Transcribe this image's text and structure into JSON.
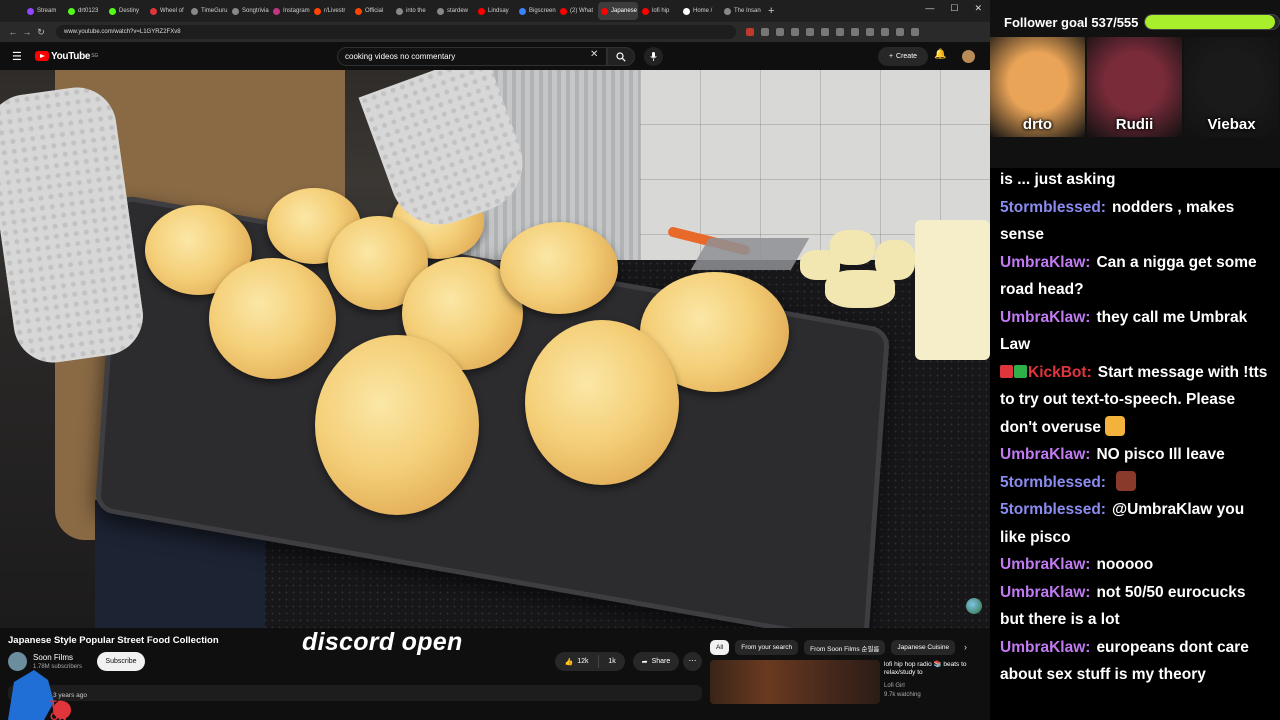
{
  "browser": {
    "tabs": [
      {
        "label": "Stream",
        "color": "#9146ff"
      },
      {
        "label": "drt0123",
        "color": "#53fc18"
      },
      {
        "label": "Destiny",
        "color": "#53fc18"
      },
      {
        "label": "Wheel of",
        "color": "#e0353b"
      },
      {
        "label": "TimeGuru",
        "color": "#888888"
      },
      {
        "label": "Songtrivia",
        "color": "#888888"
      },
      {
        "label": "Instagram",
        "color": "#c13584"
      },
      {
        "label": "r/Livestr",
        "color": "#ff4500"
      },
      {
        "label": "Official",
        "color": "#ff4500"
      },
      {
        "label": "into the",
        "color": "#888888"
      },
      {
        "label": "stardew",
        "color": "#888888"
      },
      {
        "label": "Lindsay",
        "color": "#ff0000"
      },
      {
        "label": "Bigscreen",
        "color": "#3b82f6"
      },
      {
        "label": "(2) What",
        "color": "#ff0000"
      },
      {
        "label": "Japanese",
        "color": "#ff0000",
        "active": true
      },
      {
        "label": "lofi hip",
        "color": "#ff0000"
      },
      {
        "label": "Home /",
        "color": "#ffffff"
      },
      {
        "label": "The Insane",
        "color": "#888888"
      }
    ],
    "new_tab": "+",
    "url": "www.youtube.com/watch?v=L1GYRZ2FXv8"
  },
  "youtube": {
    "logo_text": "YouTube",
    "logo_country": "SG",
    "search_value": "cooking videos no commentary",
    "create_label": "Create",
    "video_title": "Japanese Style Popular Street Food Collection",
    "overlay_caption": "discord open",
    "channel_name": "Soon Films",
    "subscribers": "1.78M subscribers",
    "subscribe_label": "Subscribe",
    "upload_age": "3 years ago",
    "like_count": "12k",
    "dislike_count": "1k",
    "share_label": "Share",
    "chips": [
      "All",
      "From your search",
      "From Soon Films 순필름",
      "Japanese Cuisine"
    ],
    "recommendation": {
      "title": "lofi hip hop radio 📚 beats to relax/study to",
      "channel": "Lofi Girl",
      "watching": "9.7k watching"
    }
  },
  "stream": {
    "follower_goal_label": "Follower goal 537/555",
    "follower_progress": 0.967,
    "members": [
      {
        "name": "drto",
        "bg": "#e9a457"
      },
      {
        "name": "Rudii",
        "bg": "#7a2b3a"
      },
      {
        "name": "Viebax",
        "bg": "#1a1a1a"
      }
    ],
    "chat": [
      {
        "user": "",
        "text": "is ... just asking",
        "color": "purple"
      },
      {
        "user": "5tormblessed:",
        "text": "nodders , makes sense",
        "color": "blue"
      },
      {
        "user": "UmbraKlaw:",
        "text": "Can a nigga get some road head?",
        "color": "purple"
      },
      {
        "user": "UmbraKlaw:",
        "text": "they call me Umbrak Law",
        "color": "purple"
      },
      {
        "user": "KickBot:",
        "text": "Start message with !tts to try out text-to-speech. Please don't overuse",
        "color": "red",
        "badges": true,
        "emote": "#f3b23c"
      },
      {
        "user": "UmbraKlaw:",
        "text": "NO pisco Ill leave",
        "color": "purple"
      },
      {
        "user": "5tormblessed:",
        "text": "",
        "color": "blue",
        "emote": "#8a3a2a"
      },
      {
        "user": "5tormblessed:",
        "text": "@UmbraKlaw you like pisco",
        "color": "blue"
      },
      {
        "user": "UmbraKlaw:",
        "text": "nooooo",
        "color": "purple"
      },
      {
        "user": "UmbraKlaw:",
        "text": "not 50/50 eurocucks but there is a lot",
        "color": "purple"
      },
      {
        "user": "UmbraKlaw:",
        "text": "europeans dont care about sex stuff is my theory",
        "color": "purple"
      }
    ]
  }
}
